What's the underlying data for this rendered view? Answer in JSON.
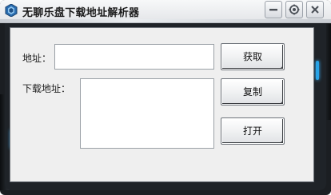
{
  "window": {
    "title": "无聊乐盘下载地址解析器",
    "controls": {
      "minimize_icon": "minimize-icon",
      "settings_icon": "gear-icon",
      "close_icon": "close-icon"
    }
  },
  "form": {
    "address_label": "地址：",
    "address_value": "",
    "download_label": "下载地址：",
    "download_value": ""
  },
  "buttons": {
    "fetch_label": "获取",
    "copy_label": "复制",
    "open_label": "打开"
  },
  "colors": {
    "frame": "#1b1e22",
    "content_bg": "#efefef",
    "accent_glow": "#29a3e6"
  }
}
